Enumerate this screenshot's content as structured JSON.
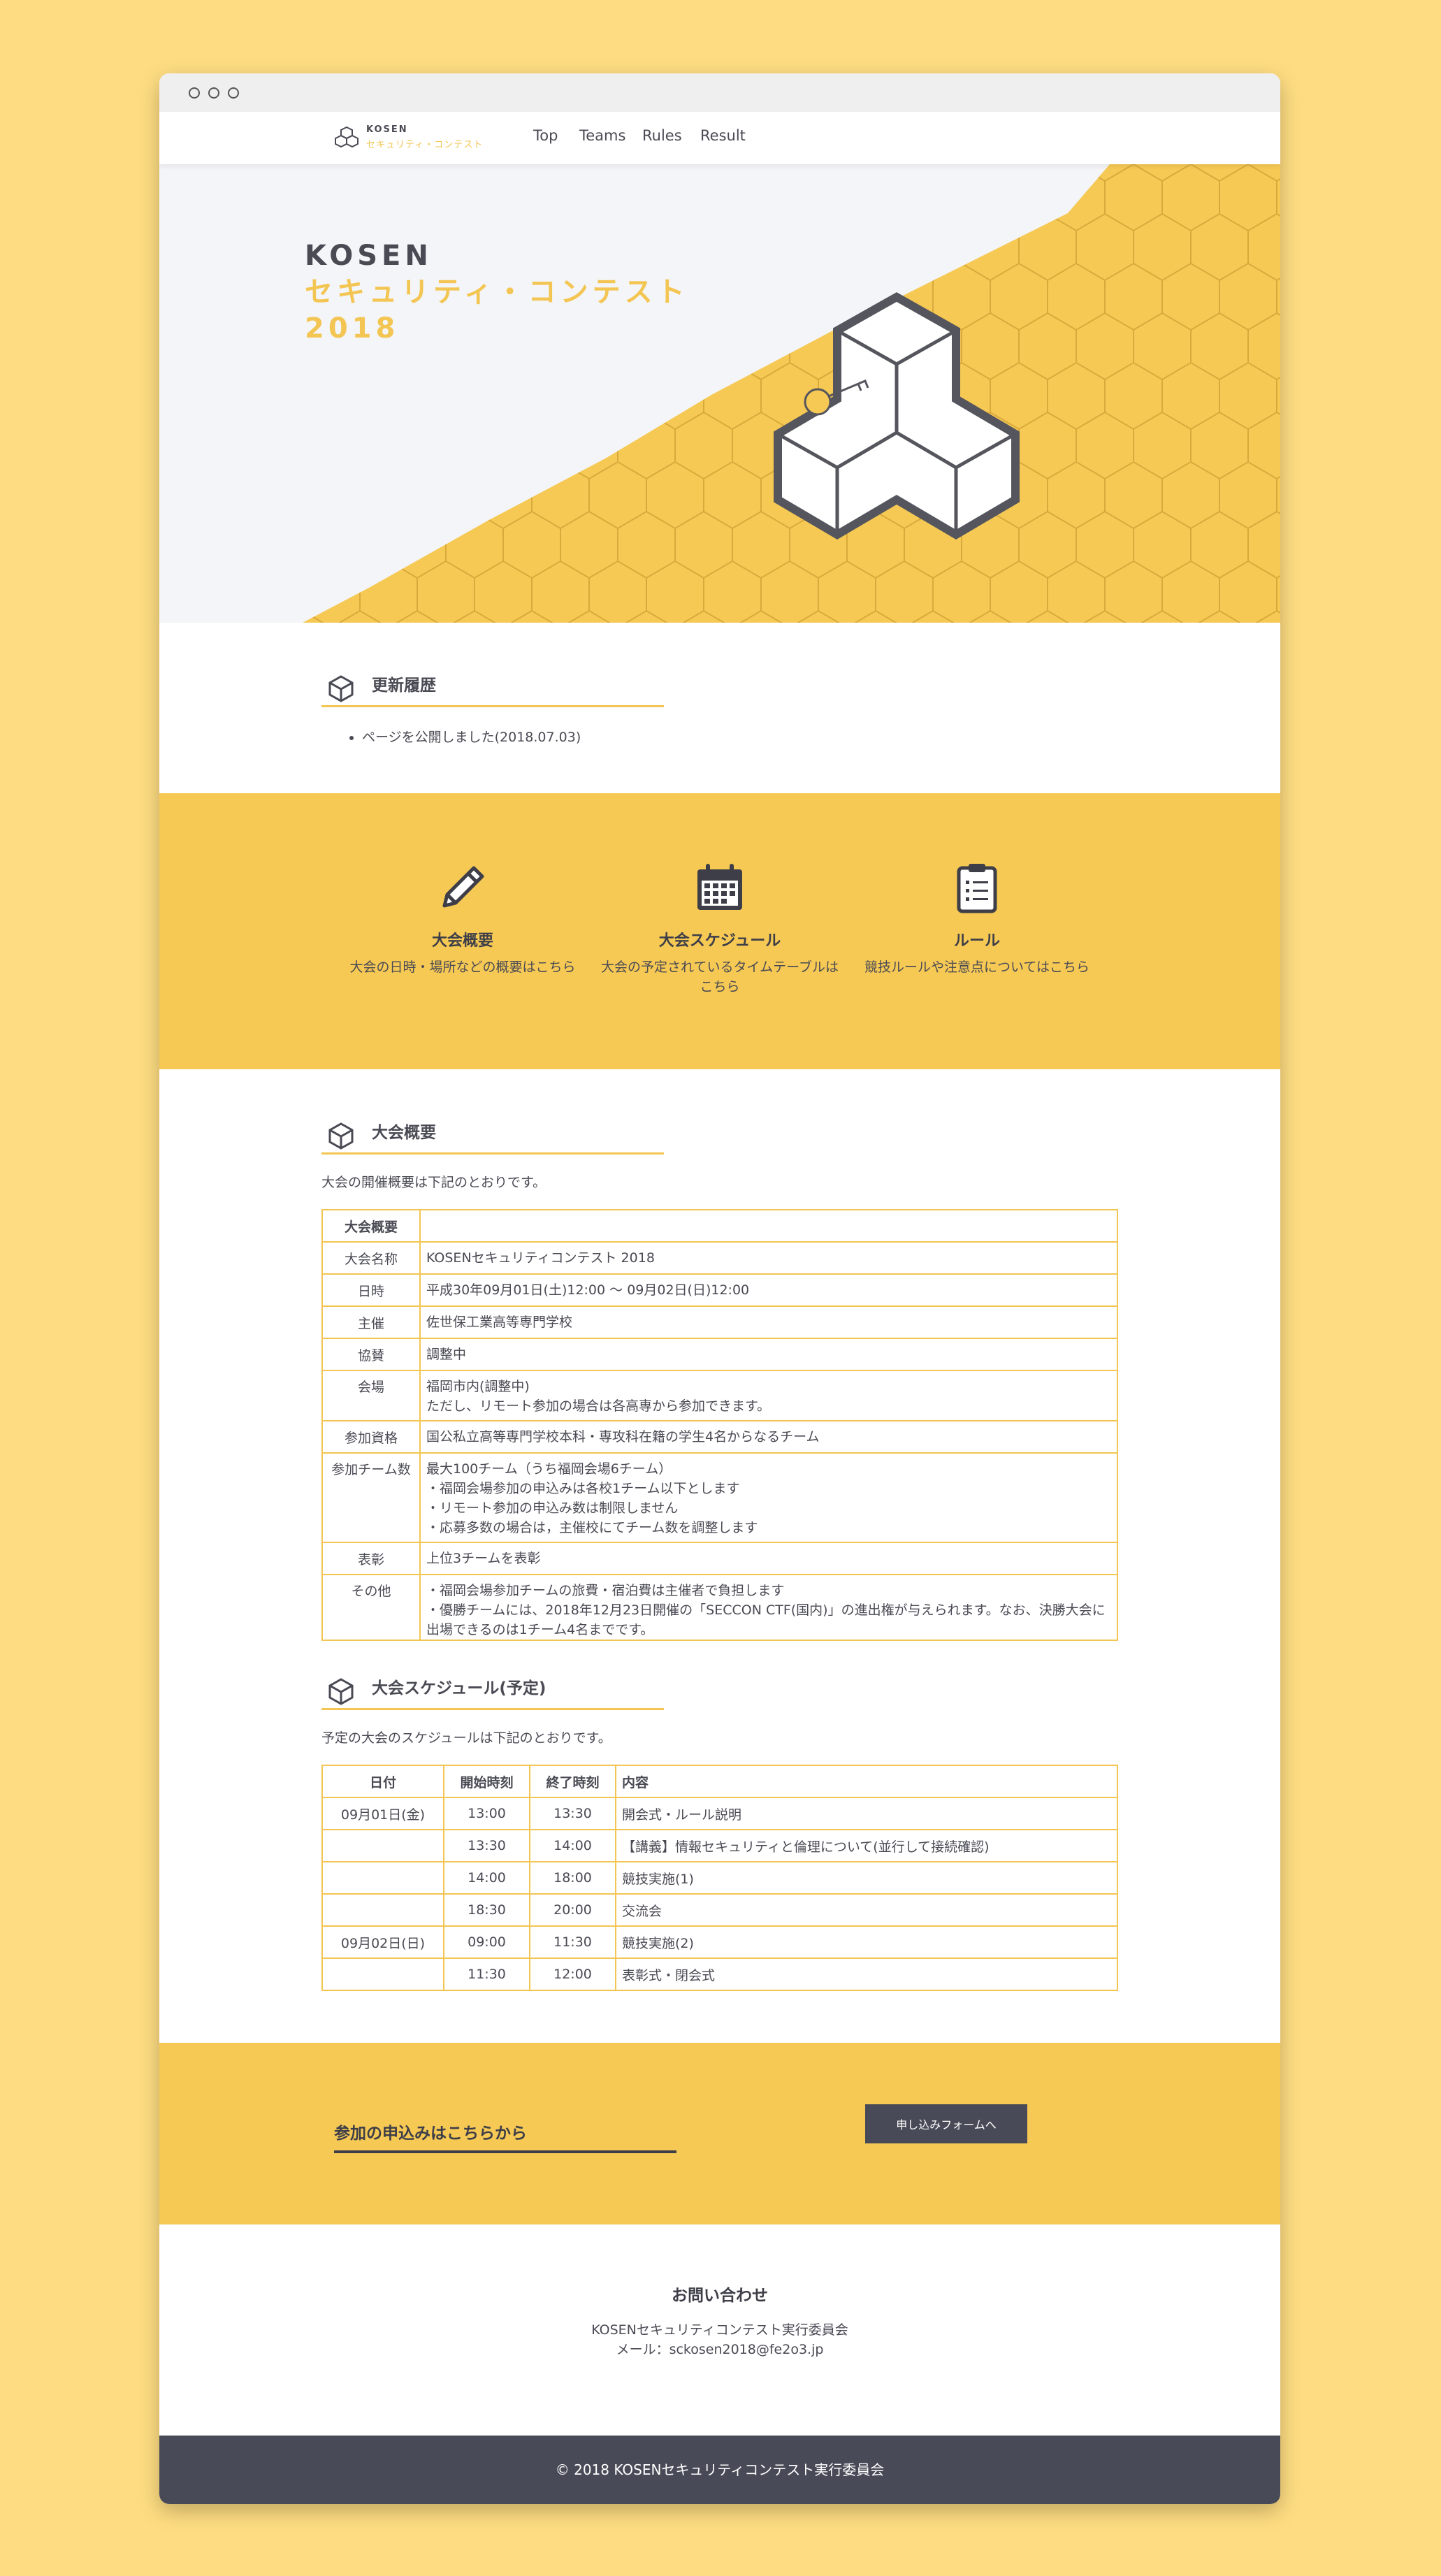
{
  "nav": {
    "logo_line1": "KOSEN",
    "logo_line2": "セキュリティ・コンテスト",
    "links": [
      "Top",
      "Teams",
      "Rules",
      "Result"
    ]
  },
  "hero": {
    "line1": "KOSEN",
    "line2": "セキュリティ・コンテスト",
    "line3": "2018"
  },
  "updates": {
    "title": "更新履歴",
    "items": [
      "ページを公開しました(2018.07.03)"
    ]
  },
  "features": [
    {
      "icon": "pencil-icon",
      "title": "大会概要",
      "desc": "大会の日時・場所などの概要はこちら"
    },
    {
      "icon": "calendar-icon",
      "title": "大会スケジュール",
      "desc": "大会の予定されているタイムテーブルはこちら"
    },
    {
      "icon": "clipboard-icon",
      "title": "ルール",
      "desc": "競技ルールや注意点についてはこちら"
    }
  ],
  "overview": {
    "title": "大会概要",
    "lead": "大会の開催概要は下記のとおりです。",
    "header": "大会概要",
    "rows": [
      {
        "label": "大会名称",
        "value": "KOSENセキュリティコンテスト 2018"
      },
      {
        "label": "日時",
        "value": "平成30年09月01日(土)12:00 〜 09月02日(日)12:00"
      },
      {
        "label": "主催",
        "value": "佐世保工業高等専門学校"
      },
      {
        "label": "協賛",
        "value": "調整中"
      },
      {
        "label": "会場",
        "value": "福岡市内(調整中)\nただし、リモート参加の場合は各高専から参加できます。"
      },
      {
        "label": "参加資格",
        "value": "国公私立高等専門学校本科・専攻科在籍の学生4名からなるチーム"
      },
      {
        "label": "参加チーム数",
        "value": "最大100チーム（うち福岡会場6チーム）\n・福岡会場参加の申込みは各校1チーム以下とします\n・リモート参加の申込み数は制限しません\n・応募多数の場合は，主催校にてチーム数を調整します"
      },
      {
        "label": "表彰",
        "value": "上位3チームを表彰"
      },
      {
        "label": "その他",
        "value": "・福岡会場参加チームの旅費・宿泊費は主催者で負担します\n・優勝チームには、2018年12月23日開催の「SECCON CTF(国内)」の進出権が与えられます。なお、決勝大会に出場できるのは1チーム4名までです。"
      }
    ]
  },
  "schedule": {
    "title": "大会スケジュール(予定)",
    "lead": "予定の大会のスケジュールは下記のとおりです。",
    "headers": [
      "日付",
      "開始時刻",
      "終了時刻",
      "内容"
    ],
    "rows": [
      [
        "09月01日(金)",
        "13:00",
        "13:30",
        "開会式・ルール説明"
      ],
      [
        "",
        "13:30",
        "14:00",
        "【講義】情報セキュリティと倫理について(並行して接続確認)"
      ],
      [
        "",
        "14:00",
        "18:00",
        "競技実施(1)"
      ],
      [
        "",
        "18:30",
        "20:00",
        "交流会"
      ],
      [
        "09月02日(日)",
        "09:00",
        "11:30",
        "競技実施(2)"
      ],
      [
        "",
        "11:30",
        "12:00",
        "表彰式・閉会式"
      ]
    ]
  },
  "cta": {
    "text": "参加の申込みはこちらから",
    "button": "申し込みフォームへ"
  },
  "contact": {
    "title": "お問い合わせ",
    "org": "KOSENセキュリティコンテスト実行委員会",
    "mail": "メール：sckosen2018@fe2o3.jp"
  },
  "footer": "© 2018 KOSENセキュリティコンテスト実行委員会",
  "colors": {
    "accent": "#f6c955",
    "dark": "#484b57",
    "page_bg": "#fedd82"
  }
}
